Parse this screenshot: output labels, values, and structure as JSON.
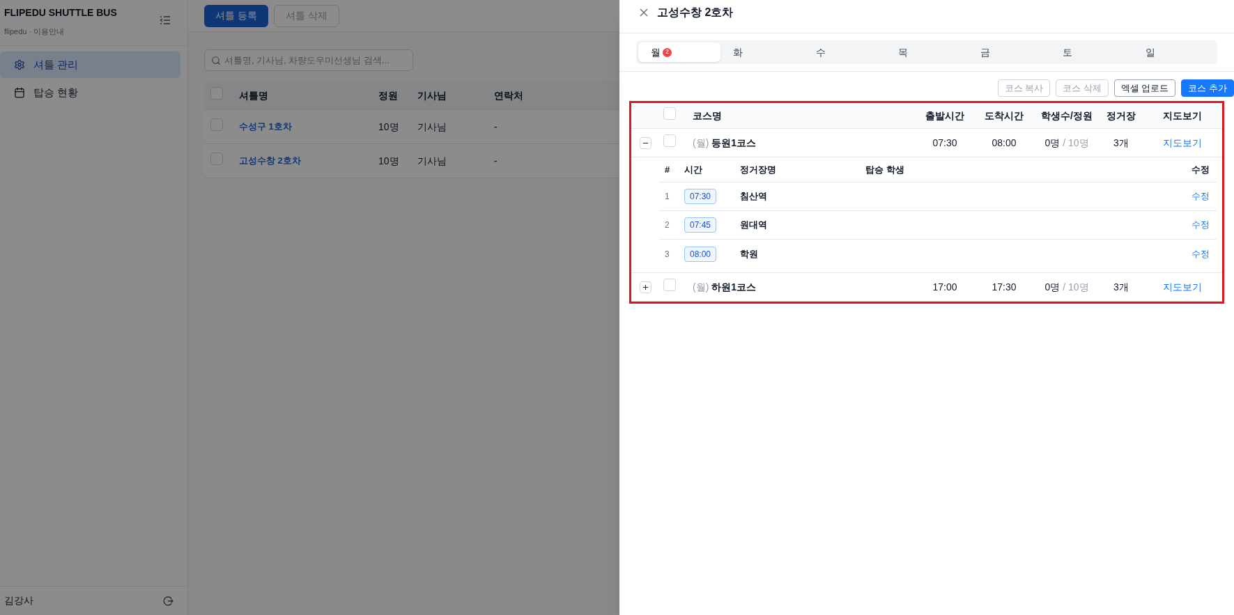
{
  "sidebar": {
    "brand": "FLIPEDU SHUTTLE BUS",
    "subtitle": "flipedu · 이용안내",
    "items": [
      {
        "label": "셔틀 관리",
        "selected": true
      },
      {
        "label": "탑승 현황",
        "selected": false
      }
    ],
    "user": "김강사"
  },
  "toolbar": {
    "buttons": [
      {
        "label": "셔틀 등록",
        "disabled": false
      },
      {
        "label": "셔틀 삭제",
        "disabled": true
      }
    ]
  },
  "search": {
    "placeholder": "셔틀명, 기사님, 차량도우미선생님 검색..."
  },
  "table": {
    "all_checked": false,
    "columns": [
      "셔틀명",
      "정원",
      "기사님",
      "연락처"
    ],
    "rows": [
      {
        "checked": false,
        "name": "수성구 1호차",
        "capacity": "10명",
        "driver": "기사님",
        "contact": "-"
      },
      {
        "checked": false,
        "name": "고성수창 2호차",
        "capacity": "10명",
        "driver": "기사님",
        "contact": "-"
      }
    ]
  },
  "drawer": {
    "title": "고성수창 2호차",
    "tabs": [
      {
        "label": "월",
        "badge": "2",
        "selected": true
      },
      {
        "label": "화",
        "selected": false
      },
      {
        "label": "수",
        "selected": false
      },
      {
        "label": "목",
        "selected": false
      },
      {
        "label": "금",
        "selected": false
      },
      {
        "label": "토",
        "selected": false
      },
      {
        "label": "일",
        "selected": false
      }
    ],
    "actions": [
      {
        "label": "코스 복사",
        "kind": "disabled"
      },
      {
        "label": "코스 삭제",
        "kind": "disabled"
      },
      {
        "label": "엑셀 업로드",
        "kind": "outline"
      },
      {
        "label": "코스 추가",
        "kind": "primary"
      }
    ],
    "courses": {
      "all_checked": false,
      "columns": [
        "코스명",
        "출발시간",
        "도착시간",
        "학생수/정원",
        "정거장",
        "지도보기"
      ],
      "rows": [
        {
          "checked": false,
          "day": "(월)",
          "name": "등원1코스",
          "depart": "07:30",
          "arrive": "08:00",
          "students": "0명",
          "capacity": "/ 10명",
          "stops_count": "3개",
          "map_link": "지도보기",
          "expanded": true,
          "stops": {
            "columns": [
              "#",
              "시간",
              "정거장명",
              "탑승 학생",
              "수정"
            ],
            "rows": [
              {
                "index": "1",
                "time": "07:30",
                "name": "침산역",
                "edit": "수정"
              },
              {
                "index": "2",
                "time": "07:45",
                "name": "원대역",
                "edit": "수정"
              },
              {
                "index": "3",
                "time": "08:00",
                "name": "학원",
                "edit": "수정"
              }
            ]
          }
        },
        {
          "checked": false,
          "day": "(월)",
          "name": "하원1코스",
          "depart": "17:00",
          "arrive": "17:30",
          "students": "0명",
          "capacity": "/ 10명",
          "stops_count": "3개",
          "map_link": "지도보기",
          "expanded": false
        }
      ]
    }
  }
}
